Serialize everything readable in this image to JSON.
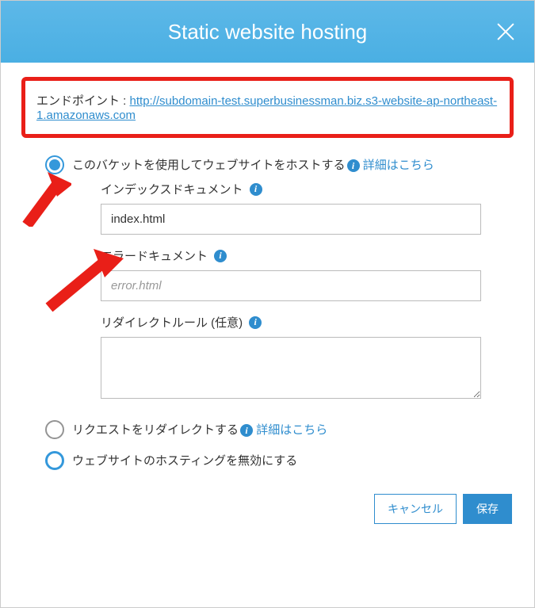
{
  "header": {
    "title": "Static website hosting"
  },
  "endpoint": {
    "label": "エンドポイント : ",
    "url": "http://subdomain-test.superbusinessman.biz.s3-website-ap-northeast-1.amazonaws.com"
  },
  "options": {
    "host": {
      "label": "このバケットを使用してウェブサイトをホストする",
      "learn_more": "詳細はこちら"
    },
    "redirect": {
      "label": "リクエストをリダイレクトする",
      "learn_more": "詳細はこちら"
    },
    "disable": {
      "label": "ウェブサイトのホスティングを無効にする"
    }
  },
  "fields": {
    "index_doc": {
      "label": "インデックスドキュメント",
      "value": "index.html"
    },
    "error_doc": {
      "label": "エラードキュメント",
      "placeholder": "error.html",
      "value": ""
    },
    "redirect_rules": {
      "label": "リダイレクトルール (任意)",
      "value": ""
    }
  },
  "footer": {
    "cancel": "キャンセル",
    "save": "保存"
  }
}
